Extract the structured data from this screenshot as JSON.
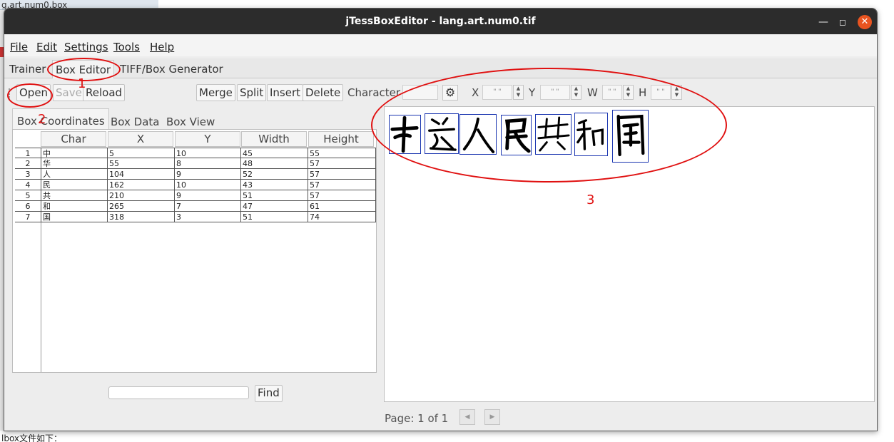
{
  "background": {
    "tab_text": "g.art.num0.box",
    "bottom_text": "lbox文件如下："
  },
  "window": {
    "title": "jTessBoxEditor - lang.art.num0.tif",
    "minimize_icon": "minimize-icon",
    "maximize_icon": "maximize-icon",
    "close_icon": "close-icon"
  },
  "menu": {
    "items": [
      "File",
      "Edit",
      "Settings",
      "Tools",
      "Help"
    ]
  },
  "main_tabs": {
    "items": [
      "Trainer",
      "Box Editor",
      "TIFF/Box Generator"
    ],
    "active": "Box Editor"
  },
  "toolbar": {
    "open": "Open",
    "save": "Save",
    "reload": "Reload",
    "merge": "Merge",
    "split": "Split",
    "insert": "Insert",
    "delete": "Delete",
    "character_label": "Character",
    "character_value": "",
    "settings_icon": "gear-icon",
    "x_label": "X",
    "y_label": "Y",
    "w_label": "W",
    "h_label": "H",
    "x_value": "\" \"",
    "y_value": "\" \"",
    "w_value": "\" \"",
    "h_value": "\" \""
  },
  "sub_tabs": {
    "items": [
      "Box Coordinates",
      "Box Data",
      "Box View"
    ],
    "active": "Box Coordinates"
  },
  "table": {
    "headers": [
      "Char",
      "X",
      "Y",
      "Width",
      "Height"
    ],
    "rows": [
      {
        "n": "1",
        "char": "中",
        "x": "5",
        "y": "10",
        "w": "45",
        "h": "55"
      },
      {
        "n": "2",
        "char": "华",
        "x": "55",
        "y": "8",
        "w": "48",
        "h": "57"
      },
      {
        "n": "3",
        "char": "人",
        "x": "104",
        "y": "9",
        "w": "52",
        "h": "57"
      },
      {
        "n": "4",
        "char": "民",
        "x": "162",
        "y": "10",
        "w": "43",
        "h": "57"
      },
      {
        "n": "5",
        "char": "共",
        "x": "210",
        "y": "9",
        "w": "51",
        "h": "57"
      },
      {
        "n": "6",
        "char": "和",
        "x": "265",
        "y": "7",
        "w": "47",
        "h": "61"
      },
      {
        "n": "7",
        "char": "国",
        "x": "318",
        "y": "3",
        "w": "51",
        "h": "74"
      }
    ]
  },
  "find": {
    "value": "",
    "button": "Find"
  },
  "pager": {
    "label": "Page: 1 of 1",
    "prev_icon": "prev-page-icon",
    "next_icon": "next-page-icon"
  },
  "annotations": {
    "labels": [
      "1",
      "2",
      "3"
    ],
    "color": "#e01010"
  },
  "colors": {
    "titlebar": "#2c2c2c",
    "close_button": "#e95420",
    "box_outline": "#1a35b0"
  }
}
